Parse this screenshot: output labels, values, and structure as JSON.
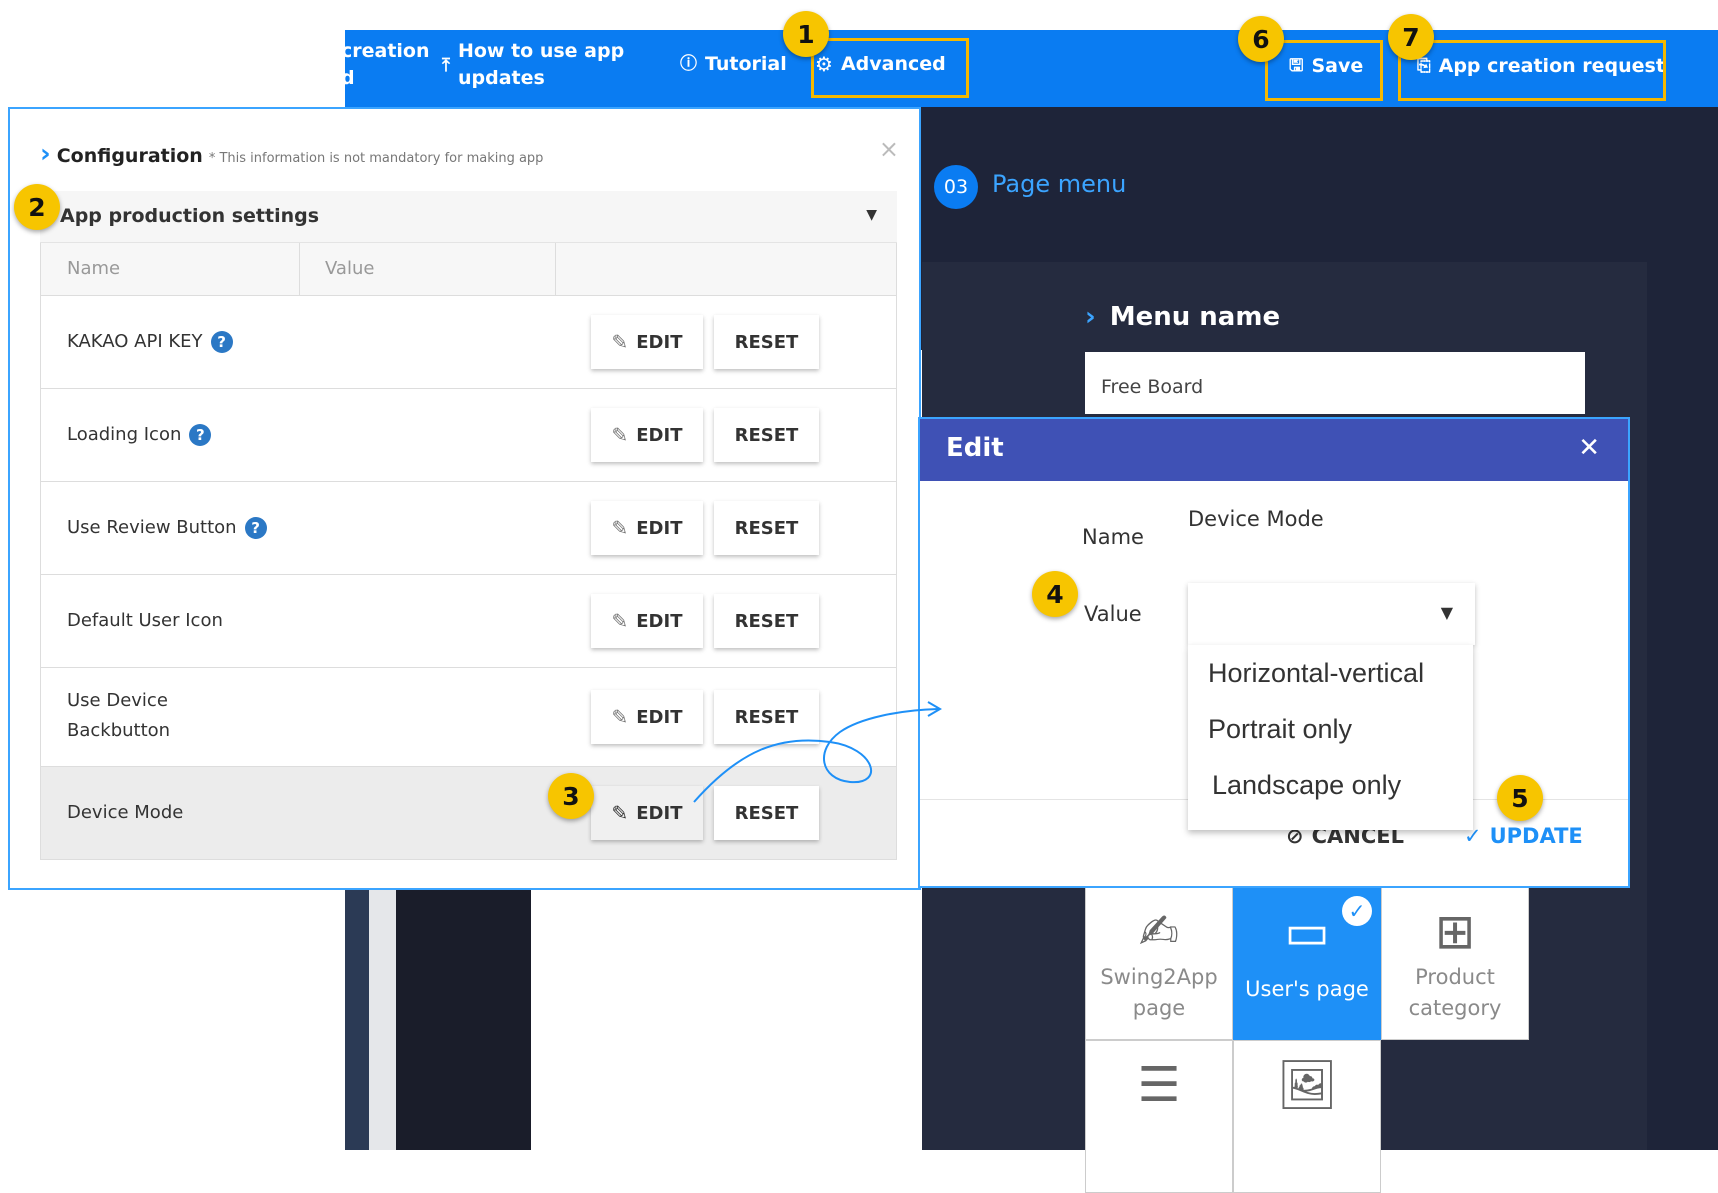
{
  "topbar": {
    "item_creation_a": "creation",
    "item_creation_b": "d",
    "item_updates_a": "How to use app",
    "item_updates_b": "updates",
    "tutorial": "Tutorial",
    "advanced": "Advanced",
    "save": "Save",
    "app_creation_request": "App creation request"
  },
  "page_menu": {
    "badge": "03",
    "title": "Page menu",
    "menu_name_label": "Menu name",
    "menu_name_value": "Free Board"
  },
  "tiles": [
    {
      "label_a": "Swing2App",
      "label_b": "page"
    },
    {
      "label_a": "User's page"
    },
    {
      "label_a": "Product",
      "label_b": "category"
    }
  ],
  "config": {
    "title": "Configuration",
    "note": "* This information is not mandatory for making app",
    "section": "App production settings",
    "col_name": "Name",
    "col_value": "Value",
    "edit_label": "EDIT",
    "reset_label": "RESET",
    "rows": [
      {
        "name": "KAKAO API KEY"
      },
      {
        "name": "Loading Icon"
      },
      {
        "name": "Use Review Button"
      },
      {
        "name": "Default User Icon"
      },
      {
        "name_a": "Use Device",
        "name_b": "Backbutton"
      },
      {
        "name": "Device Mode"
      }
    ]
  },
  "edit_dialog": {
    "title": "Edit",
    "name_label": "Name",
    "name_value": "Device Mode",
    "value_label": "Value",
    "options": [
      "Horizontal-vertical",
      "Portrait only",
      "Landscape only"
    ],
    "cancel": "CANCEL",
    "update": "UPDATE"
  },
  "markers": [
    "1",
    "2",
    "3",
    "4",
    "5",
    "6",
    "7"
  ],
  "colors": {
    "topbar": "#0a7cf2",
    "highlight": "#f5b800",
    "marker": "#f7c500",
    "dialog_header": "#3f51b5",
    "accent": "#1e90f7"
  }
}
